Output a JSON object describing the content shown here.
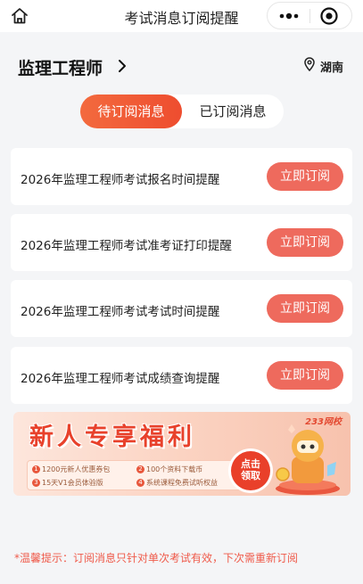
{
  "navbar": {
    "title": "考试消息订阅提醒",
    "home_icon": "home-icon",
    "more_icon": "more-dots-icon",
    "close_icon": "close-circle-icon"
  },
  "header": {
    "category": "监理工程师",
    "location": "湖南"
  },
  "tabs": [
    {
      "label": "待订阅消息",
      "active": true
    },
    {
      "label": "已订阅消息",
      "active": false
    }
  ],
  "items": [
    {
      "text": "2026年监理工程师考试报名时间提醒",
      "button": "立即订阅"
    },
    {
      "text": "2026年监理工程师考试准考证打印提醒",
      "button": "立即订阅"
    },
    {
      "text": "2026年监理工程师考试考试时间提醒",
      "button": "立即订阅"
    },
    {
      "text": "2026年监理工程师考试成绩查询提醒",
      "button": "立即订阅"
    }
  ],
  "banner": {
    "title": "新人专享福利",
    "brand": "233网校",
    "benefits": [
      {
        "num": "1",
        "text": "1200元新人优惠券包"
      },
      {
        "num": "2",
        "text": "100个资料下载币"
      },
      {
        "num": "3",
        "text": "15天V1会员体验版"
      },
      {
        "num": "4",
        "text": "系统课程免费试听权益"
      }
    ],
    "claim_line1": "点击",
    "claim_line2": "领取"
  },
  "tip": "*温馨提示：订阅消息只针对单次考试有效，下次需重新订阅",
  "colors": {
    "accent": "#ee4d2f",
    "button": "#ee6a5d",
    "tip": "#ef5b4b",
    "background": "#f4f5f7"
  }
}
